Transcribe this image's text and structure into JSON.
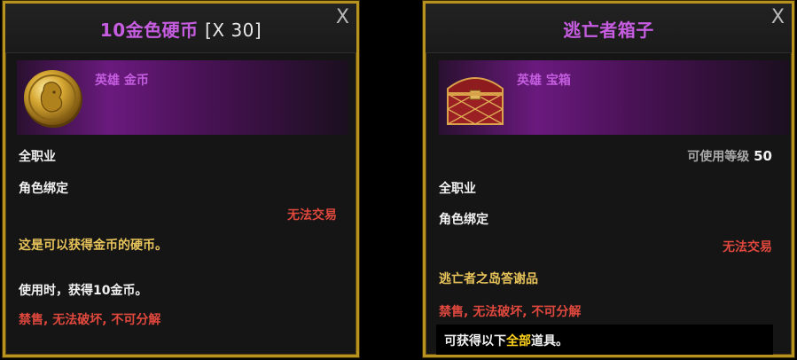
{
  "left": {
    "title_name": "10金色硬币",
    "title_qty": "[X 30]",
    "close_glyph": "X",
    "rarity": "英雄 金币",
    "job": "全职业",
    "bind": "角色绑定",
    "trade": "无法交易",
    "desc": "这是可以获得金币的硬币。",
    "use": "使用时，获得10金币。",
    "restrict": "禁售, 无法破坏, 不可分解",
    "icon": "gold-coin-icon"
  },
  "right": {
    "title": "逃亡者箱子",
    "close_glyph": "X",
    "rarity": "英雄 宝箱",
    "level_label": "可使用等级",
    "level_value": "50",
    "job": "全职业",
    "bind": "角色绑定",
    "trade": "无法交易",
    "desc": "逃亡者之岛答谢品",
    "restrict": "禁售, 无法破坏, 不可分解",
    "obtain_a": "可获得以下",
    "obtain_b": "全部",
    "obtain_c": "道具。",
    "icon": "treasure-chest-icon"
  },
  "colors": {
    "frame": "#b8921f",
    "epic": "#c45ddf",
    "red": "#e0483e",
    "gold": "#e7c35a",
    "highlight": "#ffd21d"
  }
}
